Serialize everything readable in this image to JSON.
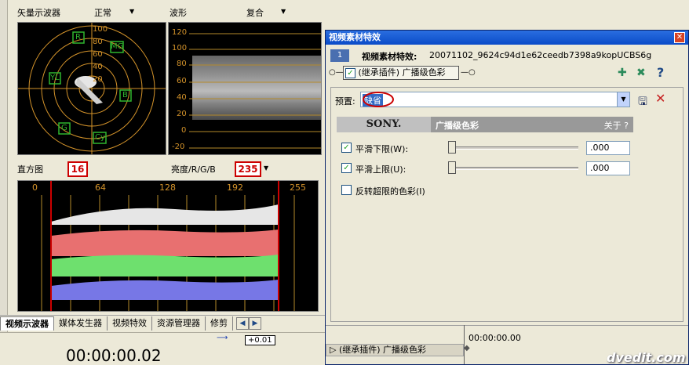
{
  "vectorscope": {
    "title": "矢量示波器",
    "mode": "正常",
    "ring_labels": [
      "100",
      "80",
      "60",
      "40",
      "20"
    ],
    "targets": [
      "R",
      "MG",
      "B",
      "Cy",
      "G",
      "YL"
    ]
  },
  "waveform": {
    "title": "波形",
    "mode": "复合",
    "y_ticks": [
      "120",
      "100",
      "80",
      "60",
      "40",
      "20",
      "0",
      "-20"
    ]
  },
  "histogram": {
    "title": "直方图",
    "mode": "亮度/R/G/B",
    "x_ticks": [
      "0",
      "64",
      "128",
      "192",
      "255"
    ],
    "marker_low": "16",
    "marker_high": "235",
    "colors": {
      "luma": "#e6e6e6",
      "red": "#e87070",
      "green": "#6ee06e",
      "blue": "#7777e6",
      "marker": "#cc0000"
    }
  },
  "tabs": [
    {
      "label": "视频示波器",
      "active": true
    },
    {
      "label": "媒体发生器",
      "active": false
    },
    {
      "label": "视频特效",
      "active": false
    },
    {
      "label": "资源管理器",
      "active": false
    },
    {
      "label": "修剪",
      "active": false
    }
  ],
  "timeline": {
    "timecode": "00:00:00.02",
    "zoom": "+0.01"
  },
  "dialog": {
    "title": "视频素材特效",
    "badge": "1",
    "clip_label": "视频素材特效:",
    "clip_name": "20071102_9624c94d1e62ceedb7398a9kopUCBS6g",
    "chain_plugin": "(继承插件) 广播级色彩",
    "preset_label": "预置:",
    "preset_value": "缺省",
    "sony_logo": "SONY.",
    "plugin_title": "广播级色彩",
    "about": "关于 ?",
    "rows": [
      {
        "label": "平滑下限(W):",
        "checked": true,
        "value": ".000"
      },
      {
        "label": "平滑上限(U):",
        "checked": true,
        "value": ".000"
      },
      {
        "label": "反转超限的色彩(I)",
        "checked": false
      }
    ],
    "bottom_chain": "(继承插件) 广播级色彩",
    "bottom_time": "00:00:00.00",
    "watermark": "dvedit.com"
  }
}
